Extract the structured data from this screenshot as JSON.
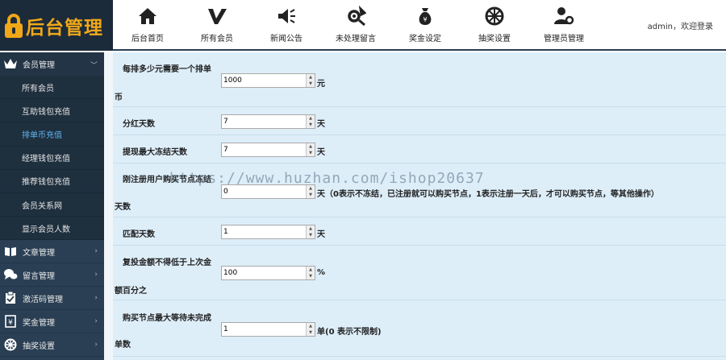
{
  "app": {
    "title": "后台管理"
  },
  "nav": [
    {
      "label": "后台首页",
      "icon": "home-icon"
    },
    {
      "label": "所有会员",
      "icon": "check-v-icon"
    },
    {
      "label": "新闻公告",
      "icon": "megaphone-icon"
    },
    {
      "label": "未处理留言",
      "icon": "tools-icon"
    },
    {
      "label": "奖金设定",
      "icon": "money-bag-icon"
    },
    {
      "label": "抽奖设置",
      "icon": "wheel-icon"
    },
    {
      "label": "管理员管理",
      "icon": "user-gear-icon"
    }
  ],
  "user": {
    "greeting": "admin，欢迎登录"
  },
  "sidebar": {
    "member_group": "会员管理",
    "member_items": [
      "所有会员",
      "互助钱包充值",
      "排单币充值",
      "经理钱包充值",
      "推荐钱包充值",
      "会员关系网",
      "显示会员人数"
    ],
    "current_item": "排单币充值",
    "groups": [
      {
        "label": "文章管理",
        "icon": "book-icon"
      },
      {
        "label": "留言管理",
        "icon": "chat-icon"
      },
      {
        "label": "激活码管理",
        "icon": "clipboard-icon"
      },
      {
        "label": "奖金管理",
        "icon": "money-doc-icon"
      },
      {
        "label": "抽奖设置",
        "icon": "wheel-icon"
      }
    ]
  },
  "form": {
    "rows": [
      {
        "label_line1": "每排多少元需要一个排单",
        "label_line2": "币",
        "value": "1000",
        "unit": "元"
      },
      {
        "label_line1": "分红天数",
        "label_line2": "",
        "value": "7",
        "unit": "天"
      },
      {
        "label_line1": "提现最大冻结天数",
        "label_line2": "",
        "value": "7",
        "unit": "天"
      },
      {
        "label_line1": "刚注册用户购买节点冻结",
        "label_line2": "天数",
        "value": "0",
        "unit": "天（0表示不冻结，已注册就可以购买节点，1表示注册一天后，才可以购买节点，等其他操作）"
      },
      {
        "label_line1": "匹配天数",
        "label_line2": "",
        "value": "1",
        "unit": "天"
      },
      {
        "label_line1": "复投金额不得低于上次金",
        "label_line2": "额百分之",
        "value": "100",
        "unit": "%"
      },
      {
        "label_line1": "购买节点最大等待未完成",
        "label_line2": "单数",
        "value": "1",
        "unit": "单(0 表示不限制)"
      }
    ]
  },
  "watermark": "https://www.huzhan.com/ishop20637"
}
